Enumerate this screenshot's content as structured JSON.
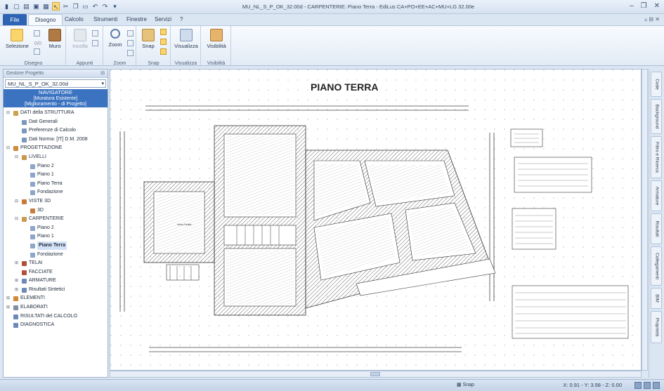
{
  "window": {
    "title": "MU_NL_S_P_OK_32.00d  -  CARPENTERIE: Piano Terra - EdiLus CA+PO+EE+AC+MU+LG 32.00e"
  },
  "tabs": {
    "file": "File",
    "items": [
      "Disegno",
      "Calcolo",
      "Strumenti",
      "Finestre",
      "Servizi",
      "?"
    ]
  },
  "ribbon": {
    "groups": [
      {
        "name": "Disegno",
        "buttons": [
          {
            "label": "Selezione",
            "icon": "cursor-icon"
          },
          {
            "label": "Muro",
            "icon": "wall-icon"
          }
        ],
        "value": "0/0"
      },
      {
        "name": "Appunti",
        "buttons": [
          {
            "label": "Incolla",
            "icon": "paste-icon"
          }
        ]
      },
      {
        "name": "Zoom",
        "buttons": [
          {
            "label": "Zoom",
            "icon": "zoom-icon"
          }
        ]
      },
      {
        "name": "Snap",
        "buttons": [
          {
            "label": "Snap",
            "icon": "snap-icon"
          }
        ]
      },
      {
        "name": "Visualizza",
        "buttons": [
          {
            "label": "Visualizza",
            "icon": "view-icon"
          }
        ]
      },
      {
        "name": "Visibilità",
        "buttons": [
          {
            "label": "Visibilità",
            "icon": "visibility-icon"
          }
        ]
      }
    ]
  },
  "panel": {
    "title": "Gestore Progetto",
    "project": "MU_NL_S_P_OK_32.00d",
    "navigator": {
      "title": "NAVIGATORE",
      "line1": "[Muratura Esistente]",
      "line2": "[Miglioramento - di Progetto]"
    },
    "tree": [
      {
        "label": "DATI della STRUTTURA",
        "level": 0,
        "expander": "⊟",
        "color": "#c9a24b"
      },
      {
        "label": "Dati Generali",
        "level": 1,
        "color": "#7e97bd"
      },
      {
        "label": "Preferenze di Calcolo",
        "level": 1,
        "color": "#7e97bd"
      },
      {
        "label": "Dati Norma: [IT] D.M. 2008",
        "level": 1,
        "color": "#7e97bd"
      },
      {
        "label": "PROGETTAZIONE",
        "level": 0,
        "expander": "⊟",
        "color": "#d08b3a"
      },
      {
        "label": "LIVELLI",
        "level": 1,
        "expander": "⊟",
        "color": "#c79a4c"
      },
      {
        "label": "Piano 2",
        "level": 2,
        "color": "#8ca7c9"
      },
      {
        "label": "Piano 1",
        "level": 2,
        "color": "#8ca7c9"
      },
      {
        "label": "Piano Terra",
        "level": 2,
        "color": "#8ca7c9"
      },
      {
        "label": "Fondazione",
        "level": 2,
        "color": "#8ca7c9"
      },
      {
        "label": "VISTE 3D",
        "level": 1,
        "expander": "⊟",
        "color": "#c77c3a"
      },
      {
        "label": "3D",
        "level": 2,
        "color": "#c77c3a"
      },
      {
        "label": "CARPENTERIE",
        "level": 1,
        "expander": "⊟",
        "color": "#c79a4c"
      },
      {
        "label": "Piano 2",
        "level": 2,
        "color": "#8ca7c9"
      },
      {
        "label": "Piano 1",
        "level": 2,
        "color": "#8ca7c9"
      },
      {
        "label": "Piano Terra",
        "level": 2,
        "color": "#8ca7c9",
        "selected": true
      },
      {
        "label": "Fondazione",
        "level": 2,
        "color": "#8ca7c9"
      },
      {
        "label": "TELAI",
        "level": 1,
        "expander": "⊞",
        "color": "#b0523a"
      },
      {
        "label": "FACCIATE",
        "level": 1,
        "color": "#b0523a"
      },
      {
        "label": "ARMATURE",
        "level": 1,
        "expander": "⊞",
        "color": "#6c8ab8"
      },
      {
        "label": "Risultati Sintetici",
        "level": 1,
        "expander": "⊞",
        "color": "#6c8ab8"
      },
      {
        "label": "ELEMENTI",
        "level": 0,
        "expander": "⊞",
        "color": "#d08b3a"
      },
      {
        "label": "ELABORATI",
        "level": 0,
        "expander": "⊞",
        "color": "#7e8fa8"
      },
      {
        "label": "RISULTATI del CALCOLO",
        "level": 0,
        "color": "#6c8ab8"
      },
      {
        "label": "DIAGNOSTICA",
        "level": 0,
        "color": "#6c8ab8"
      }
    ]
  },
  "drawing": {
    "title": "PIANO TERRA",
    "room_label": "Vano Scala"
  },
  "right_tabs": [
    "Code",
    "Background",
    "Filtro e Ricerca",
    "Armature",
    "Risultati",
    "Collegamenti",
    "BIM",
    "Proprietà"
  ],
  "status": {
    "snap": "Snap",
    "coords": "X: 0.91 - Y: 3.58 - Z: 0.00"
  }
}
